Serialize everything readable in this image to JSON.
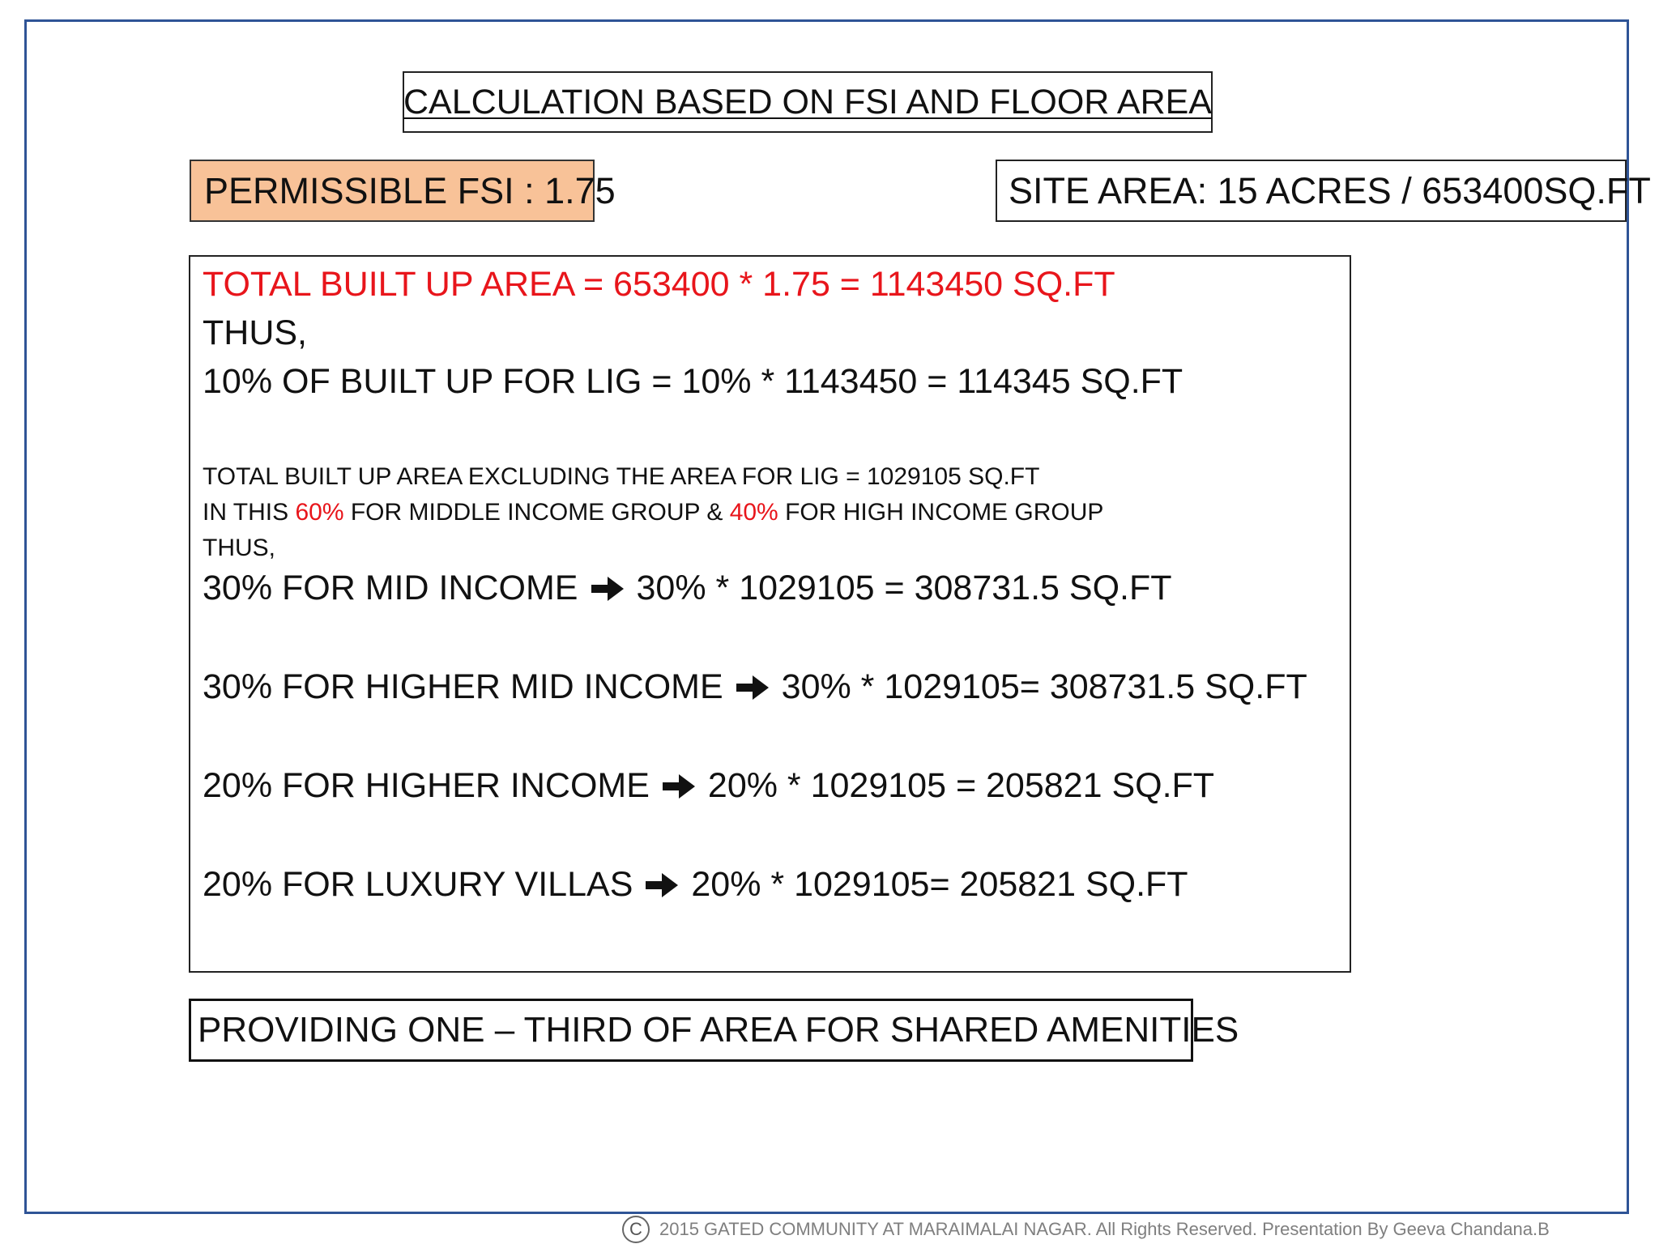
{
  "title": "CALCULATION BASED ON FSI AND FLOOR AREA",
  "fsi": "PERMISSIBLE FSI : 1.75",
  "site_area": "SITE AREA: 15 ACRES / 653400SQ.FT",
  "calc": {
    "total_built_up": "TOTAL BUILT UP AREA = 653400 * 1.75 = 1143450 SQ.FT",
    "thus_1": "THUS,",
    "lig": "10% OF BUILT UP FOR LIG = 10% * 1143450 = 114345 SQ.FT",
    "excluding": "TOTAL BUILT UP AREA EXCLUDING THE AREA FOR LIG = 1029105 SQ.FT",
    "split": {
      "prefix": "IN THIS ",
      "pct_mid": "60%",
      "middle": " FOR MIDDLE INCOME GROUP & ",
      "pct_high": "40%",
      "suffix": " FOR HIGH INCOME GROUP"
    },
    "thus_2": "THUS,",
    "rows": [
      {
        "label": "30% FOR MID INCOME",
        "result": "30% * 1029105 = 308731.5 SQ.FT"
      },
      {
        "label": "30% FOR HIGHER MID INCOME",
        "result": "30% * 1029105= 308731.5 SQ.FT"
      },
      {
        "label": "20% FOR HIGHER INCOME",
        "result": "20% * 1029105 = 205821 SQ.FT"
      },
      {
        "label": "20% FOR LUXURY VILLAS",
        "result": "20% * 1029105= 205821 SQ.FT"
      }
    ]
  },
  "amenities": "PROVIDING ONE – THIRD OF AREA FOR SHARED AMENITIES",
  "footer": {
    "copyright_symbol": "C",
    "text": "2015 GATED COMMUNITY AT MARAIMALAI NAGAR. All Rights Reserved. Presentation By Geeva Chandana.B"
  },
  "icons": [
    "arrow-right-icon",
    "copyright-icon"
  ],
  "colors": {
    "frame_border": "#2f5496",
    "fsi_fill": "#f8c298",
    "highlight_red": "#e8151b",
    "footer_text": "#7f7f7f"
  }
}
